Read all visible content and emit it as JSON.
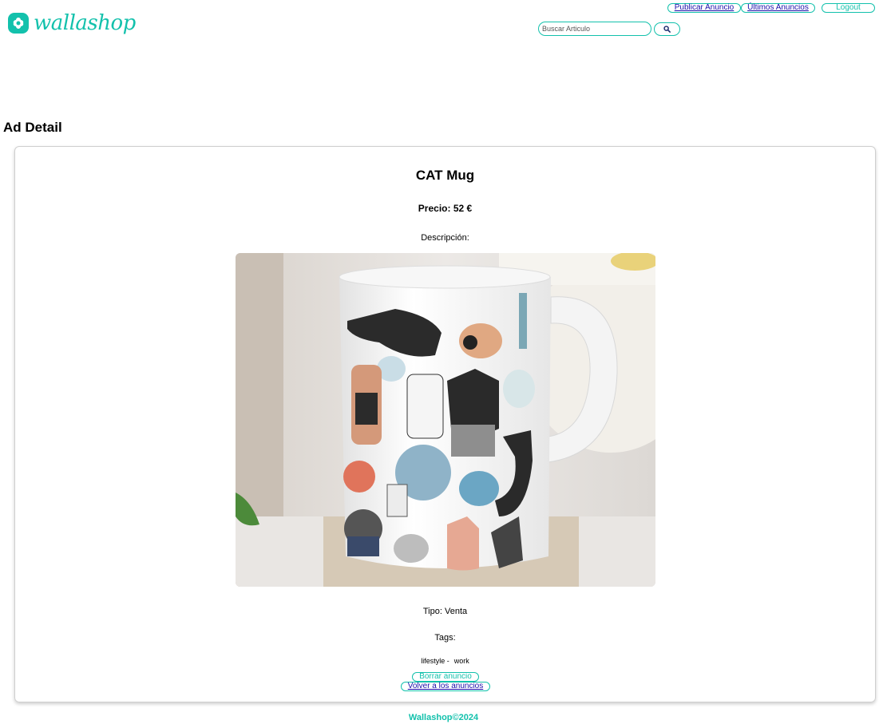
{
  "brand": {
    "name": "wallashop",
    "color": "#13c1ac"
  },
  "nav": {
    "publish_label": "Publicar Anuncio",
    "latest_label": "Últimos Anuncios",
    "logout_label": "Logout"
  },
  "search": {
    "placeholder": "Buscar Articulo",
    "value": "",
    "icon": "search-icon"
  },
  "page": {
    "heading": "Ad Detail"
  },
  "ad": {
    "title": "CAT Mug",
    "price_label": "Precio:",
    "price": "52 €",
    "description_label": "Descripción:",
    "description": "",
    "image_alt": "White mug printed with illustrated cats",
    "type_label": "Tipo:",
    "type": "Venta",
    "tags_label": "Tags:",
    "tags": [
      "lifestyle -",
      "work"
    ]
  },
  "actions": {
    "delete_label": "Borrar anuncio",
    "back_label": "Volver a los anuncios"
  },
  "footer": {
    "text": "Wallashop©2024"
  }
}
